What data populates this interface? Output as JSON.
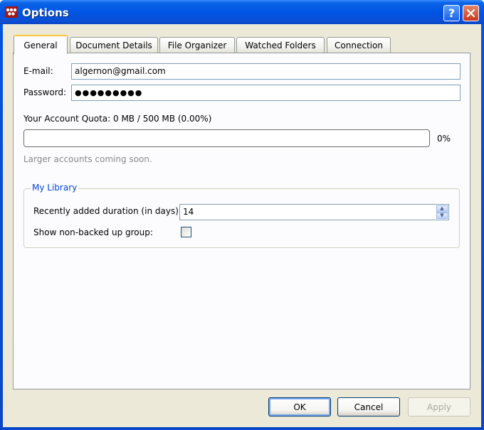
{
  "window": {
    "title": "Options"
  },
  "tabs": [
    {
      "label": "General",
      "active": true
    },
    {
      "label": "Document Details"
    },
    {
      "label": "File Organizer"
    },
    {
      "label": "Watched Folders"
    },
    {
      "label": "Connection"
    }
  ],
  "general": {
    "email_label": "E-mail:",
    "email_value": "algernon@gmail.com",
    "password_label": "Password:",
    "password_value": "●●●●●●●●●",
    "quota_text": "Your Account Quota: 0 MB / 500 MB (0.00%)",
    "quota_percent_text": "0%",
    "quota_fraction": 0,
    "larger_accounts_text": "Larger accounts coming soon."
  },
  "library": {
    "group_title": "My Library",
    "recent_label": "Recently added duration (in days):",
    "recent_value": "14",
    "show_nonbacked_label": "Show non-backed up group:",
    "show_nonbacked_checked": false
  },
  "buttons": {
    "ok": "OK",
    "cancel": "Cancel",
    "apply": "Apply"
  },
  "colors": {
    "title_bar": "#0054e3",
    "group_title": "#0046d5",
    "dialog_bg": "#ece9d8"
  },
  "icons": {
    "help": "help-icon",
    "close": "close-icon",
    "app": "mendeley-app-icon"
  }
}
